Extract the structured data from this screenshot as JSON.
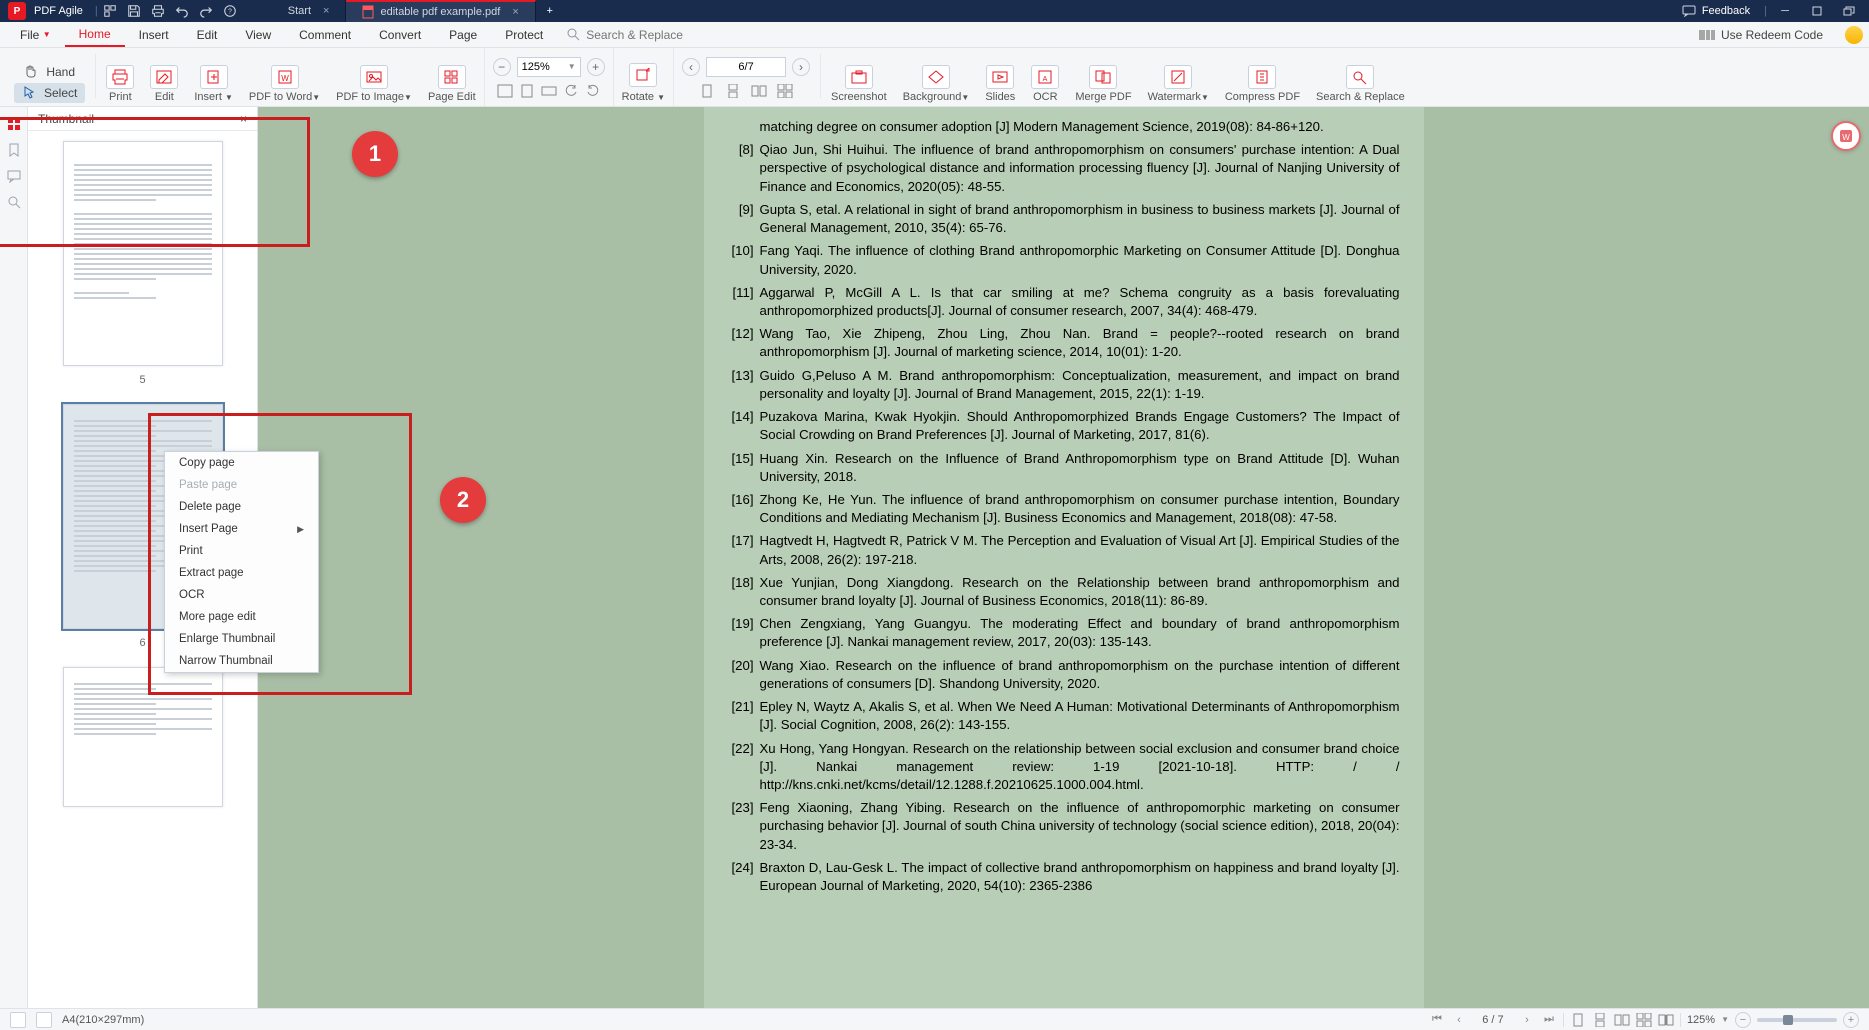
{
  "title": {
    "app_name": "PDF Agile",
    "tabs": [
      {
        "label": "Start"
      },
      {
        "label": "editable pdf example.pdf"
      }
    ],
    "feedback": "Feedback"
  },
  "menu": {
    "file": "File",
    "home": "Home",
    "insert": "Insert",
    "edit": "Edit",
    "view": "View",
    "comment": "Comment",
    "convert": "Convert",
    "page": "Page",
    "protect": "Protect",
    "search_placeholder": "Search & Replace",
    "redeem": "Use Redeem Code"
  },
  "mode": {
    "hand": "Hand",
    "select": "Select"
  },
  "ribbon": {
    "print": "Print",
    "edit": "Edit",
    "insert": "Insert",
    "pdf_to_word": "PDF to Word",
    "pdf_to_image": "PDF to Image",
    "page_edit": "Page Edit",
    "zoom_value": "125%",
    "page_value": "6/7",
    "rotate": "Rotate",
    "screenshot": "Screenshot",
    "background": "Background",
    "slides": "Slides",
    "ocr": "OCR",
    "merge_pdf": "Merge PDF",
    "watermark": "Watermark",
    "compress_pdf": "Compress PDF",
    "search_replace": "Search & Replace"
  },
  "thumbnail": {
    "title": "Thumbnail",
    "pages": [
      "5",
      "6",
      ""
    ]
  },
  "context_menu": {
    "copy_page": "Copy page",
    "paste_page": "Paste page",
    "delete_page": "Delete page",
    "insert_page": "Insert Page",
    "print": "Print",
    "extract_page": "Extract page",
    "ocr": "OCR",
    "more_page_edit": "More page edit",
    "enlarge_thumbnail": "Enlarge Thumbnail",
    "narrow_thumbnail": "Narrow Thumbnail"
  },
  "references": [
    {
      "n": "",
      "t": "matching degree on consumer adoption [J] Modern Management Science, 2019(08): 84-86+120."
    },
    {
      "n": "[8]",
      "t": "Qiao Jun, Shi Huihui. The influence of brand anthropomorphism on consumers' purchase intention: A Dual perspective of psychological distance and information processing fluency [J]. Journal of Nanjing University of Finance and Economics, 2020(05): 48-55."
    },
    {
      "n": "[9]",
      "t": "Gupta S, etal. A relational in sight of brand anthropomorphism in business to business markets [J]. Journal of General Management, 2010, 35(4): 65-76."
    },
    {
      "n": "[10]",
      "t": "Fang Yaqi. The influence of clothing Brand anthropomorphic Marketing on Consumer Attitude [D]. Donghua University, 2020."
    },
    {
      "n": "[11]",
      "t": "Aggarwal P, McGill A L. Is that car smiling at me? Schema congruity as a basis forevaluating anthropomorphized products[J]. Journal of consumer research, 2007, 34(4): 468-479."
    },
    {
      "n": "[12]",
      "t": "Wang Tao, Xie Zhipeng, Zhou Ling, Zhou Nan. Brand = people?--rooted research on brand anthropomorphism [J]. Journal of marketing science, 2014, 10(01): 1-20."
    },
    {
      "n": "[13]",
      "t": "Guido G,Peluso A M. Brand anthropomorphism: Conceptualization, measurement, and impact on brand personality and loyalty [J]. Journal of Brand Management, 2015, 22(1): 1-19."
    },
    {
      "n": "[14]",
      "t": "Puzakova Marina, Kwak Hyokjin. Should Anthropomorphized Brands Engage Customers? The Impact of Social Crowding on Brand Preferences [J]. Journal of Marketing, 2017, 81(6)."
    },
    {
      "n": "[15]",
      "t": "Huang Xin. Research on the Influence of Brand Anthropomorphism type on Brand Attitude [D]. Wuhan University, 2018."
    },
    {
      "n": "[16]",
      "t": "Zhong Ke, He Yun. The influence of brand anthropomorphism on consumer purchase intention, Boundary Conditions and Mediating Mechanism [J]. Business Economics and Management, 2018(08): 47-58."
    },
    {
      "n": "[17]",
      "t": "Hagtvedt H, Hagtvedt R, Patrick V M. The Perception and Evaluation of Visual Art [J]. Empirical Studies of the Arts, 2008, 26(2): 197-218."
    },
    {
      "n": "[18]",
      "t": "Xue Yunjian, Dong Xiangdong. Research on the Relationship between brand anthropomorphism and consumer brand loyalty [J]. Journal of Business Economics, 2018(11): 86-89."
    },
    {
      "n": "[19]",
      "t": "Chen Zengxiang, Yang Guangyu. The moderating Effect and boundary of brand anthropomorphism preference [J]. Nankai management review, 2017, 20(03): 135-143."
    },
    {
      "n": "[20]",
      "t": "Wang Xiao. Research on the influence of brand anthropomorphism on the purchase intention of different generations of consumers [D]. Shandong University, 2020."
    },
    {
      "n": "[21]",
      "t": "Epley N, Waytz A, Akalis S, et al. When We Need A Human: Motivational Determinants of Anthropomorphism [J]. Social Cognition, 2008, 26(2): 143-155."
    },
    {
      "n": "[22]",
      "t": "Xu Hong, Yang Hongyan. Research on the relationship between social exclusion and consumer brand choice [J]. Nankai management review: 1-19 [2021-10-18]. HTTP: / / http://kns.cnki.net/kcms/detail/12.1288.f.20210625.1000.004.html."
    },
    {
      "n": "[23]",
      "t": "Feng Xiaoning, Zhang Yibing. Research on the influence of anthropomorphic marketing on consumer purchasing behavior [J]. Journal of south China university of technology (social science edition), 2018, 20(04): 23-34."
    },
    {
      "n": "[24]",
      "t": "Braxton D, Lau-Gesk L. The impact of collective brand anthropomorphism on happiness and brand loyalty [J]. European Journal of Marketing, 2020, 54(10): 2365-2386"
    }
  ],
  "status": {
    "page_dim": "A4(210×297mm)",
    "page_nav": "6 / 7",
    "zoom": "125%"
  },
  "annotations": {
    "label1": "1",
    "label2": "2"
  }
}
